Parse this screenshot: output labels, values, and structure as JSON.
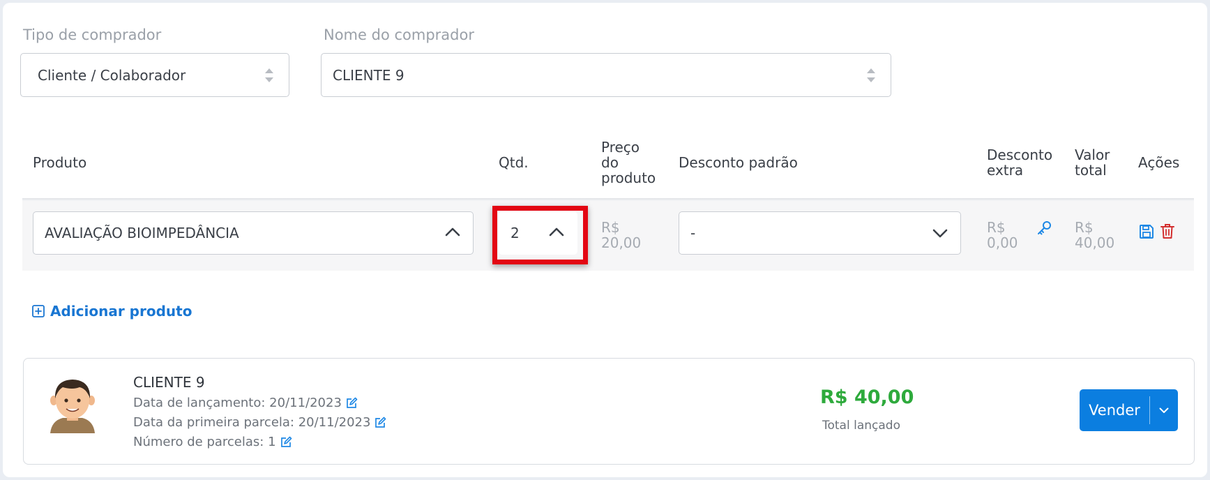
{
  "buyer": {
    "type_label": "Tipo de comprador",
    "type_value": "Cliente / Colaborador",
    "name_label": "Nome do comprador",
    "name_value": "CLIENTE 9"
  },
  "table": {
    "headers": {
      "produto": "Produto",
      "qtd": "Qtd.",
      "preco_l1": "Preço",
      "preco_l2": "do",
      "preco_l3": "produto",
      "desconto": "Desconto padrão",
      "extra_l1": "Desconto",
      "extra_l2": "extra",
      "valor_l1": "Valor",
      "valor_l2": "total",
      "acoes": "Ações"
    },
    "row": {
      "product": "AVALIAÇÃO BIOIMPEDÂNCIA",
      "qty": "2",
      "price_currency": "R$",
      "price_value": "20,00",
      "discount": "-",
      "extra_currency": "R$",
      "extra_value": "0,00",
      "total_currency": "R$",
      "total_value": "40,00"
    }
  },
  "add_product": "Adicionar produto",
  "summary": {
    "name": "CLIENTE 9",
    "launch_date": "Data de lançamento: 20/11/2023",
    "first_installment": "Data da primeira parcela: 20/11/2023",
    "installments": "Número de parcelas: 1",
    "total_value": "R$ 40,00",
    "total_label": "Total lançado",
    "sell_button": "Vender"
  },
  "colors": {
    "accent": "#0b7ee0",
    "total_green": "#2eaa3c",
    "highlight_red": "#e30613",
    "delete_red": "#d32f2f",
    "link_blue": "#1976d2"
  },
  "icons": [
    "updown-arrows-icon",
    "chevron-up-icon",
    "chevron-down-icon",
    "key-icon",
    "save-icon",
    "trash-icon",
    "plus-square-icon",
    "edit-icon",
    "avatar"
  ]
}
